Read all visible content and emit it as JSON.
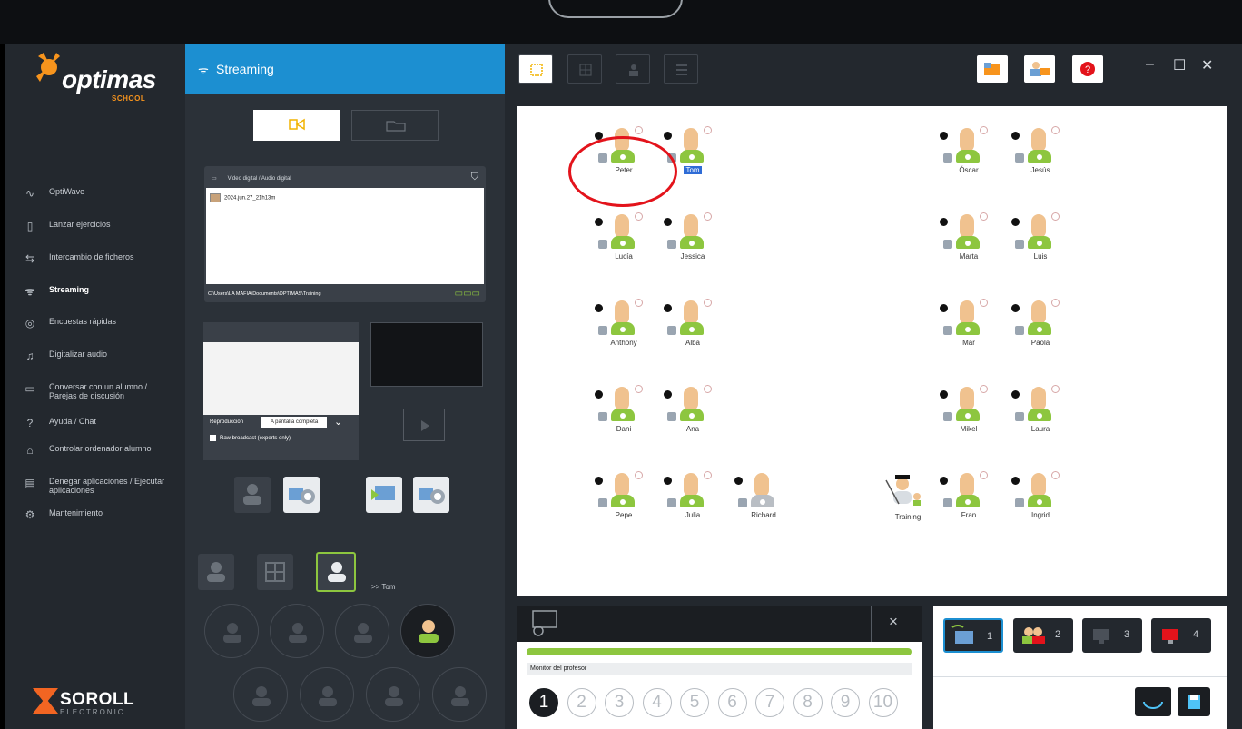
{
  "app": {
    "logo_text": "optimas",
    "logo_sub": "SCHOOL",
    "brand": "SOROLL",
    "brand_sub": "ELECTRONIC"
  },
  "sidebar": {
    "items": [
      {
        "label": "OptiWave",
        "icon": "wave-icon"
      },
      {
        "label": "Lanzar ejercicios",
        "icon": "document-icon"
      },
      {
        "label": "Intercambio de ficheros",
        "icon": "swap-icon"
      },
      {
        "label": "Streaming",
        "icon": "wifi-icon",
        "active": true
      },
      {
        "label": "Encuestas rápidas",
        "icon": "survey-icon"
      },
      {
        "label": "Digitalizar audio",
        "icon": "audio-icon"
      },
      {
        "label": "Conversar con un alumno /",
        "label2": "Parejas de discusión",
        "icon": "chat-icon"
      },
      {
        "label": "Ayuda / Chat",
        "icon": "help-icon"
      },
      {
        "label": "Controlar ordenador alumno",
        "icon": "control-icon"
      },
      {
        "label": "Denegar aplicaciones / Ejecutar",
        "label2": "aplicaciones",
        "icon": "apps-icon"
      },
      {
        "label": "Mantenimiento",
        "icon": "maintenance-icon"
      }
    ]
  },
  "streaming": {
    "title": "Streaming",
    "files_header": "Video digital / Audio digital",
    "file_item": "2024.jun.27_21h13m",
    "path": "C:\\Users\\LA MAFIA\\Documents\\OPTIMAS\\Training",
    "reproduccion_label": "Reproducción",
    "reproduccion_value": "A pantalla completa",
    "raw_broadcast": "Raw broadcast (experts only)",
    "target": ">> Tom"
  },
  "students": [
    {
      "name": "Peter"
    },
    {
      "name": "Tom",
      "selected": true
    },
    {
      "name": "Óscar"
    },
    {
      "name": "Jesús"
    },
    {
      "name": "Lucía"
    },
    {
      "name": "Jessica"
    },
    {
      "name": "Marta"
    },
    {
      "name": "Luis"
    },
    {
      "name": "Anthony"
    },
    {
      "name": "Alba"
    },
    {
      "name": "Mar"
    },
    {
      "name": "Paola"
    },
    {
      "name": "Dani"
    },
    {
      "name": "Ana"
    },
    {
      "name": "Mikel"
    },
    {
      "name": "Laura"
    },
    {
      "name": "Pepe"
    },
    {
      "name": "Julia"
    },
    {
      "name": "Richard",
      "offline": true
    },
    {
      "name": "Training",
      "teacher": true
    },
    {
      "name": "Fran"
    },
    {
      "name": "Ingrid"
    }
  ],
  "monitor": {
    "label": "Monitor del profesor",
    "close": "×",
    "pages": [
      "1",
      "2",
      "3",
      "4",
      "5",
      "6",
      "7",
      "8",
      "9",
      "10"
    ],
    "selected_page": "1"
  },
  "groups": [
    {
      "label": "1"
    },
    {
      "label": "2"
    },
    {
      "label": "3"
    },
    {
      "label": "4"
    }
  ],
  "window": {
    "minimize": "–",
    "maximize": "☐",
    "close": "✕"
  },
  "colors": {
    "accent_blue": "#1c8fd1",
    "accent_green": "#8dc63f",
    "brand_orange": "#f26522",
    "highlight_red": "#e3131b"
  }
}
